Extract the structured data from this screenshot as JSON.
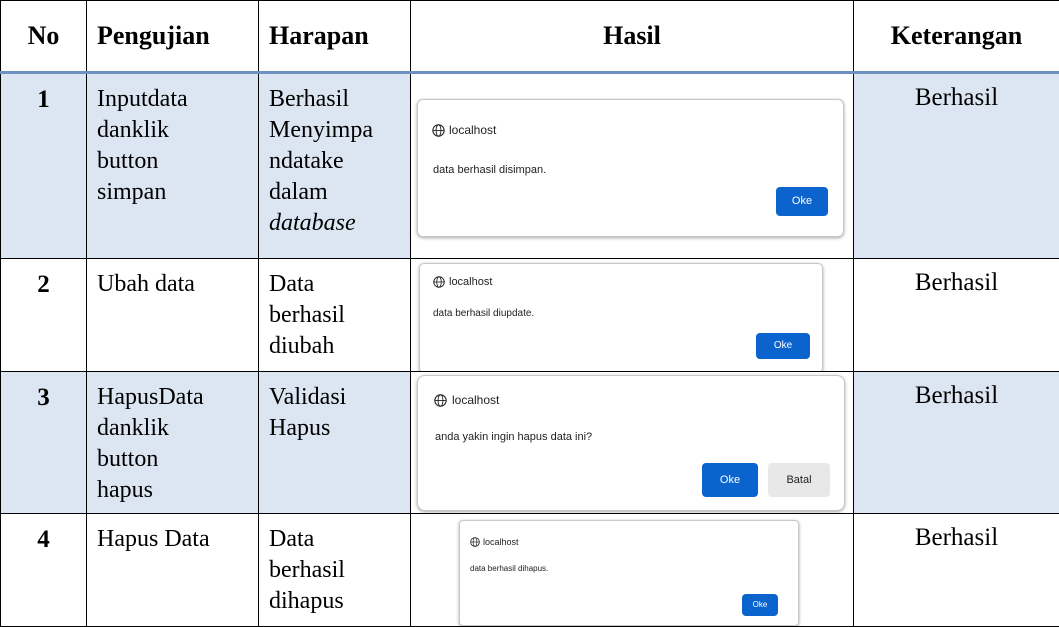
{
  "headers": {
    "no": "No",
    "pengujian": "Pengujian",
    "harapan": "Harapan",
    "hasil": "Hasil",
    "keterangan": "Keterangan"
  },
  "rows": [
    {
      "no": "1",
      "pengujian_line1_left": "Input",
      "pengujian_line1_right": "data",
      "pengujian_line2_left": "dan",
      "pengujian_line2_right": "klik",
      "pengujian_line3": "button",
      "pengujian_line4": "simpan",
      "harapan_line1": "Berhasil",
      "harapan_line2": "Menyimpa",
      "harapan_line3_left": "n",
      "harapan_line3_mid": "data",
      "harapan_line3_right": "ke",
      "harapan_line4": "dalam",
      "harapan_line5": "database",
      "dialog": {
        "host": "localhost",
        "message": "data berhasil disimpan.",
        "ok": "Oke"
      },
      "keterangan": "Berhasil"
    },
    {
      "no": "2",
      "pengujian_line1": "Ubah data",
      "harapan_line1": "Data",
      "harapan_line2": "berhasil",
      "harapan_line3": "diubah",
      "dialog": {
        "host": "localhost",
        "message": "data berhasil diupdate.",
        "ok": "Oke"
      },
      "keterangan": "Berhasil"
    },
    {
      "no": "3",
      "pengujian_line1_left": "Hapus",
      "pengujian_line1_right": "Data",
      "pengujian_line2_left": "dan",
      "pengujian_line2_right": "klik",
      "pengujian_line3": "button",
      "pengujian_line4": "hapus",
      "harapan_line1": "Validasi",
      "harapan_line2": "Hapus",
      "dialog": {
        "host": "localhost",
        "message": "anda yakin ingin hapus data ini?",
        "ok": "Oke",
        "cancel": "Batal"
      },
      "keterangan": "Berhasil"
    },
    {
      "no": "4",
      "pengujian_line1": "Hapus Data",
      "harapan_line1": "Data",
      "harapan_line2": "berhasil",
      "harapan_line3": "dihapus",
      "dialog": {
        "host": "localhost",
        "message": "data berhasil dihapus.",
        "ok": "Oke"
      },
      "keterangan": "Berhasil"
    }
  ],
  "colors": {
    "row_shade": "#dce6f2",
    "header_rule": "#6f91c1",
    "ok_button": "#0b63ce",
    "cancel_button": "#e8e8e8"
  },
  "icons": {
    "dialog_host": "globe-icon"
  }
}
